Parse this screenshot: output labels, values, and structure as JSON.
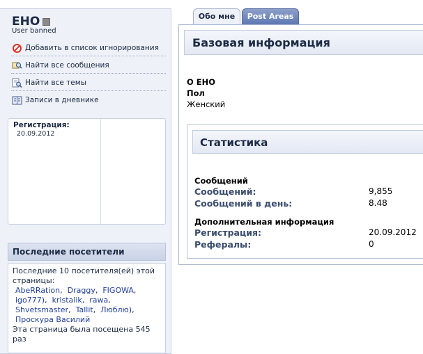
{
  "profile": {
    "username": "EHO",
    "status": "User banned",
    "actions": [
      {
        "label": "Добавить в список игнорирования",
        "icon": "ignore-icon"
      },
      {
        "label": "Найти все сообщения",
        "icon": "search-posts-icon"
      },
      {
        "label": "Найти все темы",
        "icon": "search-threads-icon"
      },
      {
        "label": "Записи в дневнике",
        "icon": "diary-icon"
      }
    ],
    "registration_label": "Регистрация:",
    "registration_date": "20.09.2012"
  },
  "visitors": {
    "title": "Последние посетители",
    "intro": "Последние 10 посетителя(ей) этой страницы:",
    "names": [
      "AbeRRation",
      "Draggy",
      "FIGOWA",
      "igo777)",
      "kristalik",
      "rawa",
      "Shvetsmaster",
      "Tallit",
      "Люблю)",
      "Проскура Василий"
    ],
    "visit_text": "Эта страница была посещена 545 раз"
  },
  "tabs": [
    {
      "label": "Обо мне",
      "active": true
    },
    {
      "label": "Post Areas",
      "active": false
    }
  ],
  "about": {
    "section_title": "Базовая информация",
    "about_title": "О EHO",
    "gender_label": "Пол",
    "gender_value": "Женский"
  },
  "stats": {
    "title": "Статистика",
    "posts_section": "Сообщений",
    "posts_label": "Сообщений:",
    "posts_value": "9,855",
    "posts_per_day_label": "Сообщений в день:",
    "posts_per_day_value": "8.48",
    "extra_section": "Дополнительная информация",
    "reg_label": "Регистрация:",
    "reg_value": "20.09.2012",
    "referrals_label": "Рефералы:",
    "referrals_value": "0"
  },
  "colors": {
    "accent": "#5f78b3",
    "panel_bg": "#eef1f8",
    "text_dark": "#1c2b45",
    "link": "#22409a",
    "ignore_icon": "#d9342b"
  }
}
